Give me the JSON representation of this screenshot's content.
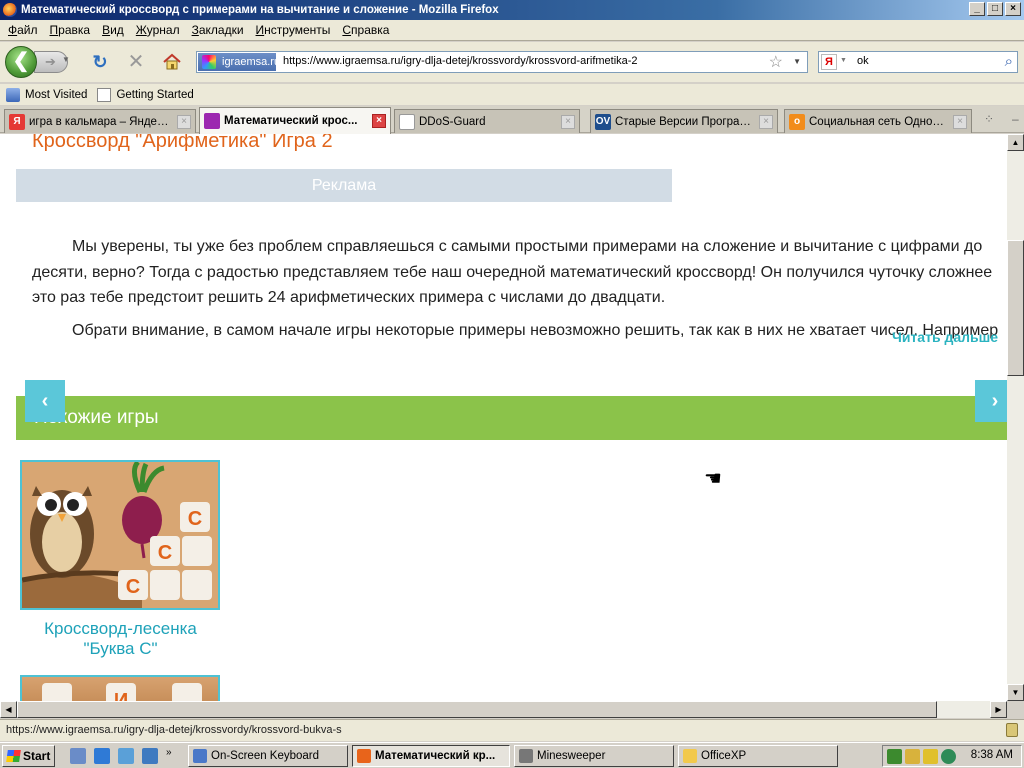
{
  "window": {
    "title": "Математический кроссворд с примерами на вычитание и сложение - Mozilla Firefox"
  },
  "menu": [
    {
      "label": "Файл",
      "u": "Ф",
      "rest": "айл"
    },
    {
      "label": "Правка",
      "u": "П",
      "rest": "равка"
    },
    {
      "label": "Вид",
      "u": "В",
      "rest": "ид"
    },
    {
      "label": "Журнал",
      "u": "Ж",
      "rest": "урнал"
    },
    {
      "label": "Закладки",
      "u": "З",
      "rest": "акладки"
    },
    {
      "label": "Инструменты",
      "u": "И",
      "rest": "нструменты"
    },
    {
      "label": "Справка",
      "u": "С",
      "rest": "правка"
    }
  ],
  "nav": {
    "site_identity": "igraemsa.ru",
    "url": "https://www.igraemsa.ru/igry-dlja-detej/krossvordy/krossvord-arifmetika-2",
    "search_value": "ok",
    "search_engine_glyph": "Я"
  },
  "bookmarks": {
    "most_visited": "Most Visited",
    "getting_started": "Getting Started"
  },
  "tabs": [
    {
      "label": "игра в кальмара – Яндекс...",
      "favicon_color": "#e53935",
      "glyph": "Я",
      "active": false
    },
    {
      "label": "Математический крос...",
      "favicon_color": "#9c27b0",
      "glyph": "",
      "active": true
    },
    {
      "label": "DDoS-Guard",
      "favicon_color": "#ffffff",
      "glyph": "",
      "active": false
    },
    {
      "label": "Старые Версии Программ...",
      "favicon_color": "#1f4e8c",
      "glyph": "OV",
      "active": false
    },
    {
      "label": "Социальная сеть Однокла...",
      "favicon_color": "#f28c1b",
      "glyph": "o",
      "active": false
    }
  ],
  "page": {
    "heading": "Кроссворд \"Арифметика\" Игра 2",
    "ad_label": "Реклама",
    "paragraph_lines": [
      "Мы уверены, ты уже без проблем справляешься с самыми простыми примерами на сложение и вычитание с цифрами до",
      "десяти, верно? Тогда с радостью представляем тебе наш очередной математический кроссворд! Он получился чуточку сложнее",
      "это раз тебе предстоит решить 24 арифметических примера с числами до двадцати."
    ],
    "paragraph2": "Обрати внимание, в самом начале игры некоторые примеры невозможно решить, так как в них не хватает чисел. Например",
    "read_more": "Читать дальше",
    "similar_header": "Похожие игры",
    "slide_prev": "‹",
    "slide_next": "›",
    "games": [
      {
        "title_line1": "Кроссворд-лесенка",
        "title_line2": "\"Буква С\""
      }
    ],
    "card_letters": [
      "С",
      "С",
      "С",
      "И"
    ]
  },
  "status": {
    "text": "https://www.igraemsa.ru/igry-dlja-detej/krossvordy/krossvord-bukva-s"
  },
  "taskbar": {
    "start": "Start",
    "buttons": [
      {
        "label": "On-Screen Keyboard",
        "active": false,
        "color": "#4a78c8"
      },
      {
        "label": "Математический кр...",
        "active": true,
        "color": "#e8641b"
      },
      {
        "label": "Minesweeper",
        "active": false,
        "color": "#777777"
      },
      {
        "label": "OfficeXP",
        "active": false,
        "color": "#f2c94c"
      }
    ],
    "clock": "8:38 AM"
  }
}
